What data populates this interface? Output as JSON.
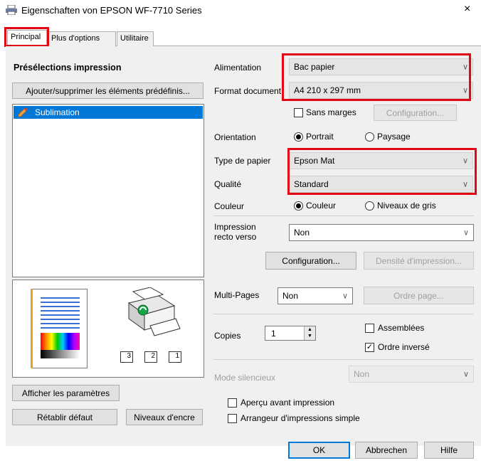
{
  "window": {
    "title": "Eigenschaften von EPSON WF-7710 Series",
    "close_glyph": "×",
    "icon": "printer-icon"
  },
  "tabs": [
    {
      "label": "Principal",
      "active": true
    },
    {
      "label": "Plus d'options",
      "active": false
    },
    {
      "label": "Utilitaire",
      "active": false
    }
  ],
  "presets": {
    "heading": "Présélections impression",
    "add_remove_button": "Ajouter/supprimer les éléments prédéfinis...",
    "items": [
      {
        "label": "Sublimation",
        "icon": "pencil-icon",
        "selected": true
      }
    ]
  },
  "left_buttons": {
    "show_settings": "Afficher les paramètres",
    "restore_defaults": "Rétablir défaut",
    "ink_levels": "Niveaux d'encre"
  },
  "preview": {
    "tray_labels": [
      "3",
      "2",
      "1"
    ]
  },
  "settings": {
    "source_label": "Alimentation",
    "source_value": "Bac papier",
    "size_label": "Format document",
    "size_value": "A4 210 x 297 mm",
    "borderless_label": "Sans marges",
    "borderless_checked": false,
    "config1_button": "Configuration...",
    "orientation_label": "Orientation",
    "portrait_label": "Portrait",
    "landscape_label": "Paysage",
    "orientation_selected": "Portrait",
    "paper_type_label": "Type de papier",
    "paper_type_value": "Epson Mat",
    "quality_label": "Qualité",
    "quality_value": "Standard",
    "color_label": "Couleur",
    "color_option_label": "Couleur",
    "grayscale_label": "Niveaux de gris",
    "color_selected": "Couleur",
    "duplex_label_line1": "Impression",
    "duplex_label_line2": "recto verso",
    "duplex_value": "Non",
    "config2_button": "Configuration...",
    "density_button": "Densité d'impression...",
    "multipage_label": "Multi-Pages",
    "multipage_value": "Non",
    "page_order_button": "Ordre page...",
    "copies_label": "Copies",
    "copies_value": "1",
    "collate_label": "Assemblées",
    "collate_checked": false,
    "reverse_label": "Ordre inversé",
    "reverse_checked": true,
    "quiet_label": "Mode silencieux",
    "quiet_value": "Non",
    "preview_label": "Aperçu avant impression",
    "preview_checked": false,
    "arranger_label": "Arrangeur d'impressions simple",
    "arranger_checked": false
  },
  "footer": {
    "ok": "OK",
    "cancel": "Abbrechen",
    "help": "Hilfe"
  },
  "colors": {
    "highlight": "#e30613",
    "selection": "#0078d7",
    "panel": "#f0f0f0"
  }
}
